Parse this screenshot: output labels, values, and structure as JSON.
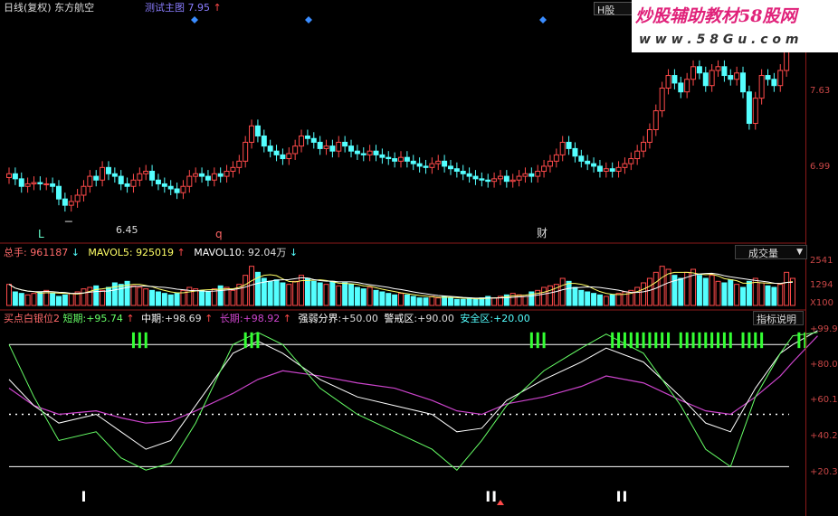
{
  "header": {
    "chart_title": "日线(复权)",
    "stock_name": "东方航空",
    "main_indicator": "测试主图",
    "main_value": "7.95",
    "up_arrow": "↑",
    "h_label": "H股"
  },
  "watermark": {
    "text": "炒股辅助教材58股网",
    "url": "w w w . 5 8 G u . c o m"
  },
  "price_axis": {
    "labels": [
      "7.63",
      "6.99"
    ]
  },
  "price_markers": {
    "low_label": "6.45",
    "letter_l": "L",
    "letter_q": "q",
    "letter_cai": "财"
  },
  "volume": {
    "title": "总手",
    "value": "961187",
    "mavol5_label": "MAVOL5",
    "mavol5_value": "925019",
    "mavol10_label": "MAVOL10",
    "mavol10_value": "92.04万",
    "selector": "成交量",
    "axis": [
      "2541",
      "1294",
      "X100"
    ]
  },
  "indicator": {
    "title": "买点白银位2",
    "short_label": "短期",
    "short_value": "+95.74",
    "mid_label": "中期",
    "mid_value": "+98.69",
    "long_label": "长期",
    "long_value": "+98.92",
    "strength_label": "强弱分界",
    "strength_value": "+50.00",
    "alert_label": "警戒区",
    "alert_value": "+90.00",
    "safe_label": "安全区",
    "safe_value": "+20.00",
    "help": "指标说明",
    "axis": [
      "+99.9",
      "+80.0",
      "+60.1",
      "+40.2",
      "+20.3"
    ]
  },
  "colors": {
    "up": "#ff4a4a",
    "down": "#54ffff",
    "short": "#66ff66",
    "mid": "#ffffff",
    "long": "#cc44cc",
    "axis": "#8b1a1a"
  },
  "chart_data": [
    {
      "type": "candlestick",
      "title": "日线(复权) 东方航空",
      "ylabels": [
        "7.63",
        "6.99"
      ],
      "low_marker": 6.45,
      "close": [
        6.8,
        6.76,
        6.7,
        6.72,
        6.73,
        6.72,
        6.72,
        6.7,
        6.6,
        6.55,
        6.58,
        6.63,
        6.7,
        6.78,
        6.75,
        6.85,
        6.8,
        6.78,
        6.72,
        6.7,
        6.75,
        6.8,
        6.82,
        6.75,
        6.72,
        6.7,
        6.68,
        6.65,
        6.7,
        6.78,
        6.8,
        6.78,
        6.75,
        6.8,
        6.78,
        6.82,
        6.85,
        6.9,
        7.05,
        7.18,
        7.1,
        7.02,
        6.98,
        6.95,
        6.92,
        6.96,
        7.02,
        7.1,
        7.08,
        7.05,
        7.0,
        7.02,
        6.98,
        7.05,
        7.02,
        6.98,
        6.96,
        6.95,
        6.98,
        6.95,
        6.93,
        6.92,
        6.9,
        6.93,
        6.9,
        6.88,
        6.86,
        6.85,
        6.88,
        6.9,
        6.86,
        6.84,
        6.82,
        6.8,
        6.78,
        6.76,
        6.75,
        6.74,
        6.76,
        6.78,
        6.74,
        6.75,
        6.78,
        6.8,
        6.78,
        6.82,
        6.86,
        6.9,
        6.95,
        7.05,
        7.0,
        6.94,
        6.9,
        6.88,
        6.86,
        6.82,
        6.84,
        6.82,
        6.85,
        6.88,
        6.92,
        6.98,
        7.05,
        7.15,
        7.3,
        7.48,
        7.58,
        7.52,
        7.45,
        7.55,
        7.65,
        7.6,
        7.5,
        7.62,
        7.65,
        7.58,
        7.55,
        7.6,
        7.45,
        7.2,
        7.4,
        7.58,
        7.55,
        7.5,
        7.62,
        7.9,
        7.95
      ],
      "ylim": [
        6.3,
        8.0
      ]
    },
    {
      "type": "bar",
      "title": "总手",
      "series": [
        {
          "name": "总手",
          "value": 961187
        },
        {
          "name": "MAVOL5",
          "value": 925019
        },
        {
          "name": "MAVOL10",
          "value": "92.04万"
        }
      ],
      "ylabels": [
        "2541",
        "1294",
        "X100"
      ],
      "values": [
        1.4,
        0.9,
        0.8,
        0.7,
        0.8,
        0.9,
        1.0,
        0.8,
        0.6,
        0.7,
        0.8,
        0.9,
        1.1,
        1.2,
        1.3,
        1.0,
        1.2,
        1.5,
        1.4,
        1.6,
        1.3,
        1.2,
        1.1,
        1.0,
        0.9,
        0.8,
        0.7,
        0.8,
        1.0,
        1.2,
        1.1,
        1.0,
        0.9,
        1.1,
        1.3,
        1.2,
        1.0,
        1.4,
        2.0,
        2.6,
        2.2,
        1.8,
        1.6,
        1.7,
        1.5,
        1.4,
        1.6,
        2.0,
        1.8,
        1.6,
        1.5,
        1.4,
        1.6,
        1.3,
        1.5,
        1.4,
        1.2,
        1.1,
        1.2,
        1.0,
        0.9,
        0.8,
        0.7,
        0.8,
        0.7,
        0.6,
        0.5,
        0.5,
        0.6,
        0.5,
        0.6,
        0.5,
        0.4,
        0.4,
        0.5,
        0.4,
        0.5,
        0.6,
        0.5,
        0.6,
        0.7,
        0.8,
        0.7,
        0.6,
        0.9,
        1.0,
        1.2,
        1.3,
        1.4,
        1.8,
        1.6,
        1.2,
        1.0,
        0.9,
        0.8,
        0.7,
        0.6,
        0.7,
        0.8,
        0.9,
        1.0,
        1.2,
        1.5,
        1.8,
        2.2,
        2.6,
        2.4,
        2.0,
        1.8,
        2.2,
        2.4,
        2.0,
        1.8,
        2.0,
        1.6,
        1.5,
        1.7,
        1.4,
        1.2,
        1.6,
        1.8,
        1.5,
        1.3,
        1.2,
        1.4,
        2.2,
        1.8
      ],
      "ylim": [
        0,
        3.0
      ]
    },
    {
      "type": "line",
      "title": "买点白银位2",
      "series": [
        {
          "name": "短期",
          "value": 95.74
        },
        {
          "name": "中期",
          "value": 98.69
        },
        {
          "name": "长期",
          "value": 98.92
        },
        {
          "name": "强弱分界",
          "value": 50.0
        },
        {
          "name": "警戒区",
          "value": 90.0
        },
        {
          "name": "安全区",
          "value": 20.0
        }
      ],
      "ylabels": [
        "+99.9",
        "+80.0",
        "+60.1",
        "+40.2",
        "+20.3"
      ],
      "short_x": [
        0,
        4,
        8,
        14,
        18,
        22,
        26,
        30,
        36,
        40,
        44,
        50,
        56,
        62,
        68,
        72,
        76,
        80,
        86,
        92,
        96,
        102,
        108,
        112,
        116,
        120,
        124,
        126,
        130
      ],
      "short_y": [
        90,
        60,
        35,
        40,
        25,
        18,
        22,
        45,
        90,
        97,
        90,
        65,
        50,
        40,
        30,
        18,
        35,
        55,
        75,
        88,
        96,
        85,
        55,
        30,
        20,
        60,
        85,
        95,
        97
      ],
      "mid_y": [
        70,
        55,
        45,
        50,
        40,
        30,
        35,
        55,
        85,
        92,
        85,
        70,
        60,
        55,
        50,
        40,
        42,
        58,
        70,
        80,
        88,
        80,
        60,
        45,
        40,
        65,
        85,
        90,
        98
      ],
      "long_y": [
        65,
        55,
        50,
        52,
        48,
        45,
        46,
        52,
        62,
        70,
        75,
        72,
        68,
        65,
        58,
        52,
        50,
        56,
        60,
        66,
        72,
        68,
        58,
        52,
        50,
        60,
        72,
        80,
        95
      ],
      "ylim": [
        0,
        100
      ]
    }
  ]
}
